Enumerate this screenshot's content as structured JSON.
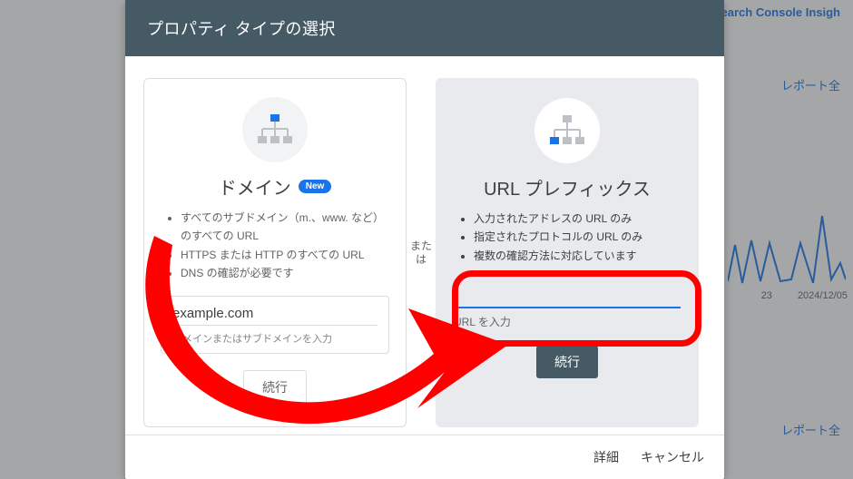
{
  "background": {
    "top_link": "Search Console Insigh",
    "side_link_1": "レポート全",
    "side_link_2": "レポート全",
    "dates": [
      "23",
      "2024/12/05"
    ]
  },
  "modal": {
    "title": "プロパティ タイプの選択",
    "separator_a": "また",
    "separator_b": "は",
    "left": {
      "title": "ドメイン",
      "badge": "New",
      "bullets": [
        "すべてのサブドメイン（m.、www. など）のすべての URL",
        "HTTPS または HTTP のすべての URL",
        "DNS の確認が必要です"
      ],
      "input_value": "example.com",
      "input_helper": "ドメインまたはサブドメインを入力",
      "continue": "続行"
    },
    "right": {
      "title": "URL プレフィックス",
      "bullets": [
        "入力されたアドレスの URL のみ",
        "指定されたプロトコルの URL のみ",
        "複数の確認方法に対応しています"
      ],
      "input_value": "",
      "input_helper": "URL を入力",
      "continue": "続行"
    },
    "footer": {
      "detail": "詳細",
      "cancel": "キャンセル"
    }
  }
}
